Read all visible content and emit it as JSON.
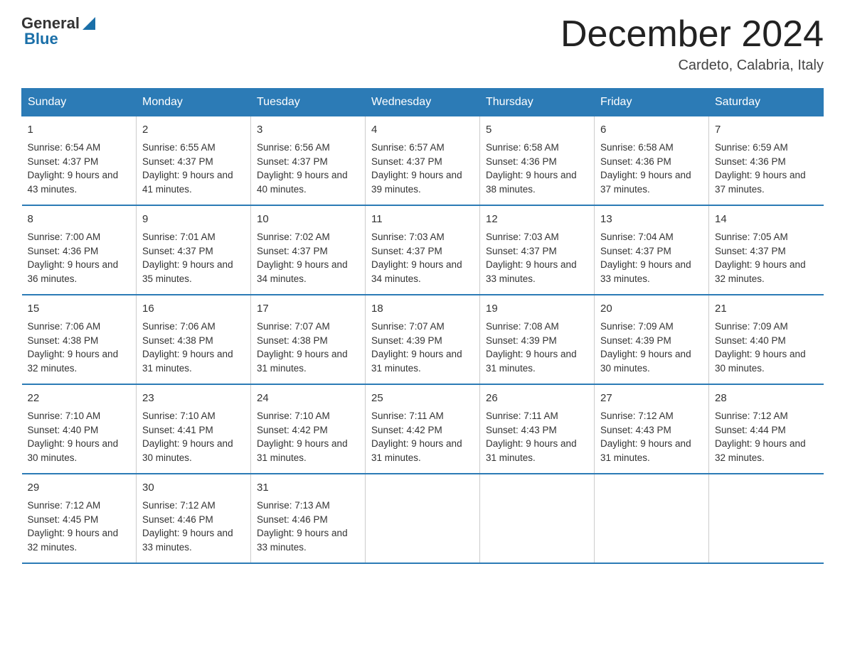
{
  "logo": {
    "general": "General",
    "blue": "Blue"
  },
  "title": "December 2024",
  "location": "Cardeto, Calabria, Italy",
  "days_of_week": [
    "Sunday",
    "Monday",
    "Tuesday",
    "Wednesday",
    "Thursday",
    "Friday",
    "Saturday"
  ],
  "weeks": [
    [
      {
        "day": "1",
        "sunrise": "6:54 AM",
        "sunset": "4:37 PM",
        "daylight": "9 hours and 43 minutes."
      },
      {
        "day": "2",
        "sunrise": "6:55 AM",
        "sunset": "4:37 PM",
        "daylight": "9 hours and 41 minutes."
      },
      {
        "day": "3",
        "sunrise": "6:56 AM",
        "sunset": "4:37 PM",
        "daylight": "9 hours and 40 minutes."
      },
      {
        "day": "4",
        "sunrise": "6:57 AM",
        "sunset": "4:37 PM",
        "daylight": "9 hours and 39 minutes."
      },
      {
        "day": "5",
        "sunrise": "6:58 AM",
        "sunset": "4:36 PM",
        "daylight": "9 hours and 38 minutes."
      },
      {
        "day": "6",
        "sunrise": "6:58 AM",
        "sunset": "4:36 PM",
        "daylight": "9 hours and 37 minutes."
      },
      {
        "day": "7",
        "sunrise": "6:59 AM",
        "sunset": "4:36 PM",
        "daylight": "9 hours and 37 minutes."
      }
    ],
    [
      {
        "day": "8",
        "sunrise": "7:00 AM",
        "sunset": "4:36 PM",
        "daylight": "9 hours and 36 minutes."
      },
      {
        "day": "9",
        "sunrise": "7:01 AM",
        "sunset": "4:37 PM",
        "daylight": "9 hours and 35 minutes."
      },
      {
        "day": "10",
        "sunrise": "7:02 AM",
        "sunset": "4:37 PM",
        "daylight": "9 hours and 34 minutes."
      },
      {
        "day": "11",
        "sunrise": "7:03 AM",
        "sunset": "4:37 PM",
        "daylight": "9 hours and 34 minutes."
      },
      {
        "day": "12",
        "sunrise": "7:03 AM",
        "sunset": "4:37 PM",
        "daylight": "9 hours and 33 minutes."
      },
      {
        "day": "13",
        "sunrise": "7:04 AM",
        "sunset": "4:37 PM",
        "daylight": "9 hours and 33 minutes."
      },
      {
        "day": "14",
        "sunrise": "7:05 AM",
        "sunset": "4:37 PM",
        "daylight": "9 hours and 32 minutes."
      }
    ],
    [
      {
        "day": "15",
        "sunrise": "7:06 AM",
        "sunset": "4:38 PM",
        "daylight": "9 hours and 32 minutes."
      },
      {
        "day": "16",
        "sunrise": "7:06 AM",
        "sunset": "4:38 PM",
        "daylight": "9 hours and 31 minutes."
      },
      {
        "day": "17",
        "sunrise": "7:07 AM",
        "sunset": "4:38 PM",
        "daylight": "9 hours and 31 minutes."
      },
      {
        "day": "18",
        "sunrise": "7:07 AM",
        "sunset": "4:39 PM",
        "daylight": "9 hours and 31 minutes."
      },
      {
        "day": "19",
        "sunrise": "7:08 AM",
        "sunset": "4:39 PM",
        "daylight": "9 hours and 31 minutes."
      },
      {
        "day": "20",
        "sunrise": "7:09 AM",
        "sunset": "4:39 PM",
        "daylight": "9 hours and 30 minutes."
      },
      {
        "day": "21",
        "sunrise": "7:09 AM",
        "sunset": "4:40 PM",
        "daylight": "9 hours and 30 minutes."
      }
    ],
    [
      {
        "day": "22",
        "sunrise": "7:10 AM",
        "sunset": "4:40 PM",
        "daylight": "9 hours and 30 minutes."
      },
      {
        "day": "23",
        "sunrise": "7:10 AM",
        "sunset": "4:41 PM",
        "daylight": "9 hours and 30 minutes."
      },
      {
        "day": "24",
        "sunrise": "7:10 AM",
        "sunset": "4:42 PM",
        "daylight": "9 hours and 31 minutes."
      },
      {
        "day": "25",
        "sunrise": "7:11 AM",
        "sunset": "4:42 PM",
        "daylight": "9 hours and 31 minutes."
      },
      {
        "day": "26",
        "sunrise": "7:11 AM",
        "sunset": "4:43 PM",
        "daylight": "9 hours and 31 minutes."
      },
      {
        "day": "27",
        "sunrise": "7:12 AM",
        "sunset": "4:43 PM",
        "daylight": "9 hours and 31 minutes."
      },
      {
        "day": "28",
        "sunrise": "7:12 AM",
        "sunset": "4:44 PM",
        "daylight": "9 hours and 32 minutes."
      }
    ],
    [
      {
        "day": "29",
        "sunrise": "7:12 AM",
        "sunset": "4:45 PM",
        "daylight": "9 hours and 32 minutes."
      },
      {
        "day": "30",
        "sunrise": "7:12 AM",
        "sunset": "4:46 PM",
        "daylight": "9 hours and 33 minutes."
      },
      {
        "day": "31",
        "sunrise": "7:13 AM",
        "sunset": "4:46 PM",
        "daylight": "9 hours and 33 minutes."
      },
      null,
      null,
      null,
      null
    ]
  ],
  "labels": {
    "sunrise": "Sunrise:",
    "sunset": "Sunset:",
    "daylight": "Daylight:"
  }
}
